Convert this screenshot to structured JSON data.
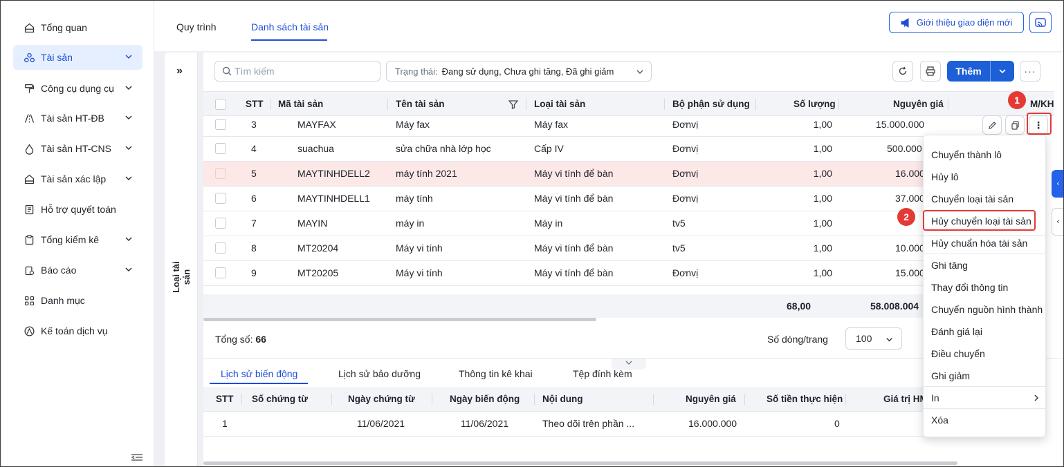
{
  "sidebar": {
    "items": [
      {
        "label": "Tổng quan",
        "icon": "home-icon",
        "has_chevron": false,
        "active": false
      },
      {
        "label": "Tài sản",
        "icon": "assets-icon",
        "has_chevron": true,
        "active": true
      },
      {
        "label": "Công cụ dụng cụ",
        "icon": "paint-roller-icon",
        "has_chevron": true,
        "active": false
      },
      {
        "label": "Tài sản HT-ĐB",
        "icon": "road-icon",
        "has_chevron": true,
        "active": false
      },
      {
        "label": "Tài sản HT-CNS",
        "icon": "water-drop-icon",
        "has_chevron": true,
        "active": false
      },
      {
        "label": "Tài sản xác lập",
        "icon": "house-icon",
        "has_chevron": true,
        "active": false
      },
      {
        "label": "Hỗ trợ quyết toán",
        "icon": "document-icon",
        "has_chevron": false,
        "active": false
      },
      {
        "label": "Tổng kiểm kê",
        "icon": "clipboard-icon",
        "has_chevron": true,
        "active": false
      },
      {
        "label": "Báo cáo",
        "icon": "report-icon",
        "has_chevron": true,
        "active": false
      },
      {
        "label": "Danh mục",
        "icon": "grid-icon",
        "has_chevron": false,
        "active": false
      },
      {
        "label": "Kế toán dịch vụ",
        "icon": "service-icon",
        "has_chevron": false,
        "active": false
      }
    ]
  },
  "header": {
    "tabs": [
      {
        "label": "Quy trình",
        "active": false
      },
      {
        "label": "Danh sách tài sản",
        "active": true
      }
    ],
    "intro_button": "Giới thiệu giao diện mới"
  },
  "side_panel": {
    "label": "Loại tài sản"
  },
  "toolbar": {
    "search_placeholder": "Tìm kiếm",
    "status_label": "Trạng thái:",
    "status_value": "Đang sử dụng, Chưa ghi tăng, Đã ghi giảm",
    "add_label": "Thêm"
  },
  "table": {
    "columns": [
      "STT",
      "Mã tài sản",
      "Tên tài sản",
      "Loại tài sản",
      "Bộ phận sử dụng",
      "Số lượng",
      "Nguyên giá",
      "M/KH"
    ],
    "rows": [
      {
        "stt": "3",
        "code": "MAYFAX",
        "name": "Máy fax",
        "type": "Máy fax",
        "dept": "Đơnvị",
        "qty": "1,00",
        "price": "15.000.000",
        "highlight": false
      },
      {
        "stt": "4",
        "code": "suachua",
        "name": "sửa chữa nhà lớp học",
        "type": "Cấp IV",
        "dept": "Đơnvị",
        "qty": "1,00",
        "price": "500.000",
        "highlight": false
      },
      {
        "stt": "5",
        "code": "MAYTINHDELL2",
        "name": "máy tính 2021",
        "type": "Máy vi tính để bàn",
        "dept": "Đơnvị",
        "qty": "1,00",
        "price": "16.000",
        "highlight": true
      },
      {
        "stt": "6",
        "code": "MAYTINHDELL1",
        "name": "máy tính",
        "type": "Máy vi tính để bàn",
        "dept": "Đơnvị",
        "qty": "1,00",
        "price": "37.000",
        "highlight": false
      },
      {
        "stt": "7",
        "code": "MAYIN",
        "name": "máy in",
        "type": "Máy in",
        "dept": "tv5",
        "qty": "1,00",
        "price": "",
        "highlight": false
      },
      {
        "stt": "8",
        "code": "MT20204",
        "name": "Máy vi tính",
        "type": "Máy vi tính để bàn",
        "dept": "tv5",
        "qty": "1,00",
        "price": "10.000",
        "highlight": false
      },
      {
        "stt": "9",
        "code": "MT20205",
        "name": "Máy vi tính",
        "type": "Máy vi tính để bàn",
        "dept": "Đơnvị",
        "qty": "1,00",
        "price": "15.000",
        "highlight": false
      }
    ],
    "sum_qty": "68,00",
    "sum_price": "58.008.004"
  },
  "pagination": {
    "total_label": "Tổng số:",
    "total_value": "66",
    "per_page_label": "Số dòng/trang",
    "per_page_value": "100"
  },
  "bottom": {
    "tabs": [
      {
        "label": "Lịch sử biến động",
        "active": true
      },
      {
        "label": "Lịch sử bảo dưỡng",
        "active": false
      },
      {
        "label": "Thông tin kê khai",
        "active": false
      },
      {
        "label": "Tệp đính kèm",
        "active": false
      }
    ],
    "columns": [
      "STT",
      "Số chứng từ",
      "Ngày chứng từ",
      "Ngày biến động",
      "Nội dung",
      "Nguyên giá",
      "Số tiền thực hiện",
      "Giá trị HM"
    ],
    "rows": [
      {
        "stt": "1",
        "doc_no": "",
        "doc_date": "11/06/2021",
        "change_date": "11/06/2021",
        "content": "Theo dõi trên phần ...",
        "price": "16.000.000",
        "amount": "0"
      }
    ]
  },
  "context_menu": {
    "items": [
      "Chuyển thành lô",
      "Hủy lô",
      "Chuyển loại tài sản",
      "Hủy chuyển loại tài sản",
      "Hủy chuẩn hóa tài sản",
      "Ghi tăng",
      "Thay đổi thông tin",
      "Chuyển nguồn hình thành",
      "Đánh giá lại",
      "Điều chuyển",
      "Ghi giảm",
      "In",
      "Xóa"
    ]
  },
  "annotations": {
    "badge1": "1",
    "badge2": "2"
  },
  "colors": {
    "accent": "#1d4ed8",
    "highlight_row": "#fde8e8",
    "annotation_red": "#e53935"
  }
}
